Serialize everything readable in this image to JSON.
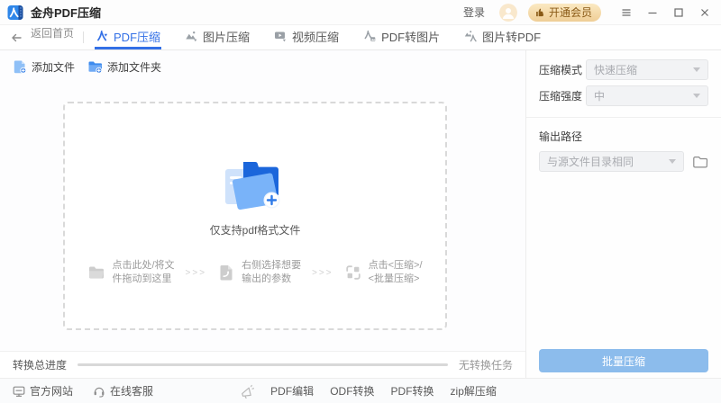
{
  "titlebar": {
    "app_title": "金舟PDF压缩",
    "login_label": "登录",
    "vip_label": "开通会员"
  },
  "navbar": {
    "back_label": "返回首页",
    "tabs": [
      {
        "label": "PDF压缩",
        "active": true
      },
      {
        "label": "图片压缩",
        "active": false
      },
      {
        "label": "视频压缩",
        "active": false
      },
      {
        "label": "PDF转图片",
        "active": false
      },
      {
        "label": "图片转PDF",
        "active": false
      }
    ]
  },
  "toolbar": {
    "add_file_label": "添加文件",
    "add_folder_label": "添加文件夹"
  },
  "dropzone": {
    "hint": "仅支持pdf格式文件",
    "separator": ">>>",
    "steps": [
      {
        "line1": "点击此处/将文",
        "line2": "件拖动到这里"
      },
      {
        "line1": "右侧选择想要",
        "line2": "输出的参数"
      },
      {
        "line1": "点击<压缩>/",
        "line2": "<批量压缩>"
      }
    ]
  },
  "sidebar": {
    "mode_label": "压缩模式",
    "mode_value": "快速压缩",
    "strength_label": "压缩强度",
    "strength_value": "中",
    "output_label": "输出路径",
    "output_value": "与源文件目录相同",
    "batch_button_label": "批量压缩"
  },
  "statusbar": {
    "progress_label": "转换总进度",
    "progress_percent": 0,
    "status_text": "无转换任务"
  },
  "footer": {
    "official_site_label": "官方网站",
    "support_label": "在线客服",
    "promo_links": [
      {
        "label": "PDF编辑"
      },
      {
        "label": "ODF转换"
      },
      {
        "label": "PDF转换"
      },
      {
        "label": "zip解压缩"
      }
    ]
  },
  "colors": {
    "accent_blue": "#3370e6",
    "batch_button_blue": "#8cbcec",
    "vip_gold": "#efce96",
    "folder_icon_blue": "#79b3f9",
    "folder_icon_dark_blue": "#1b66db"
  }
}
